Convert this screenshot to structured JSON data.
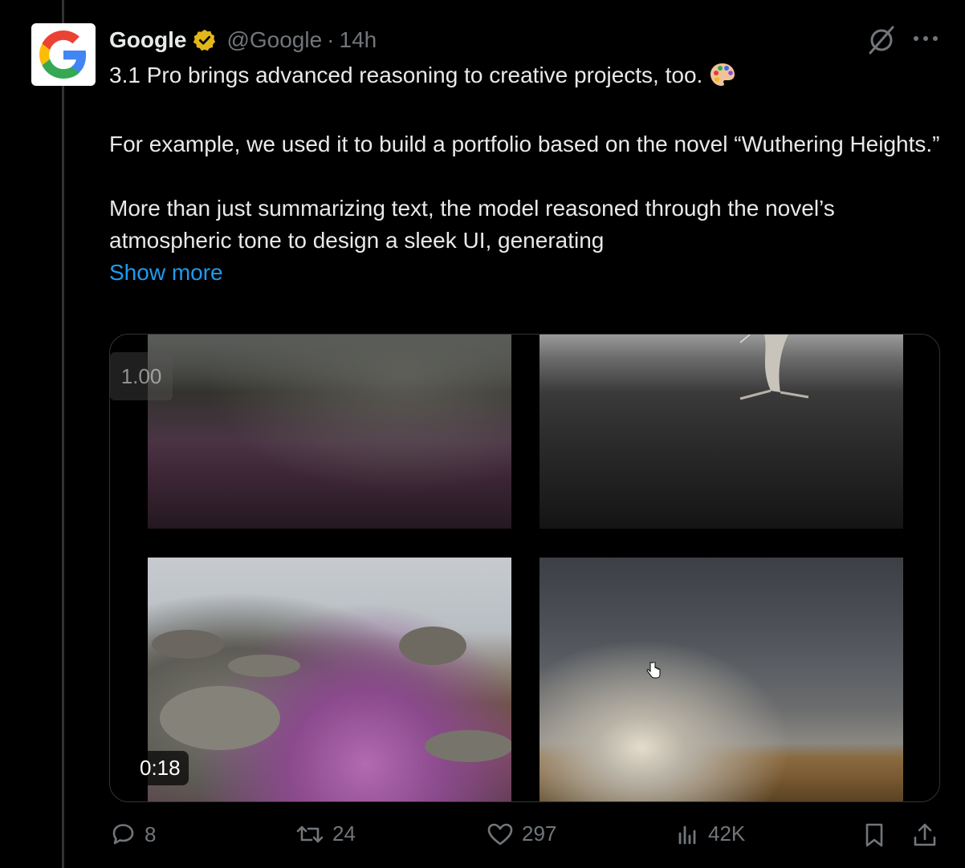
{
  "tweet": {
    "author_name": "Google",
    "handle": "@Google",
    "separator": "·",
    "time": "14h",
    "text_line1": "3.1 Pro brings advanced reasoning to creative projects, too.",
    "text_para2": "For example, we used it to build a portfolio based on the novel “Wuthering Heights.”",
    "text_para3": "More than just summarizing text, the model reasoned through the novel’s atmospheric tone to design a sleek UI, generating",
    "show_more": "Show more",
    "emoji_icon": "palette-emoji-icon"
  },
  "media": {
    "playback_speed": "1.00",
    "duration": "0:18"
  },
  "actions": {
    "replies": "8",
    "reposts": "24",
    "likes": "297",
    "views": "42K"
  },
  "colors": {
    "background": "#000000",
    "text": "#e7e9ea",
    "muted": "#71767b",
    "link": "#1d9bf0",
    "verified_badge": "#e2b719"
  }
}
